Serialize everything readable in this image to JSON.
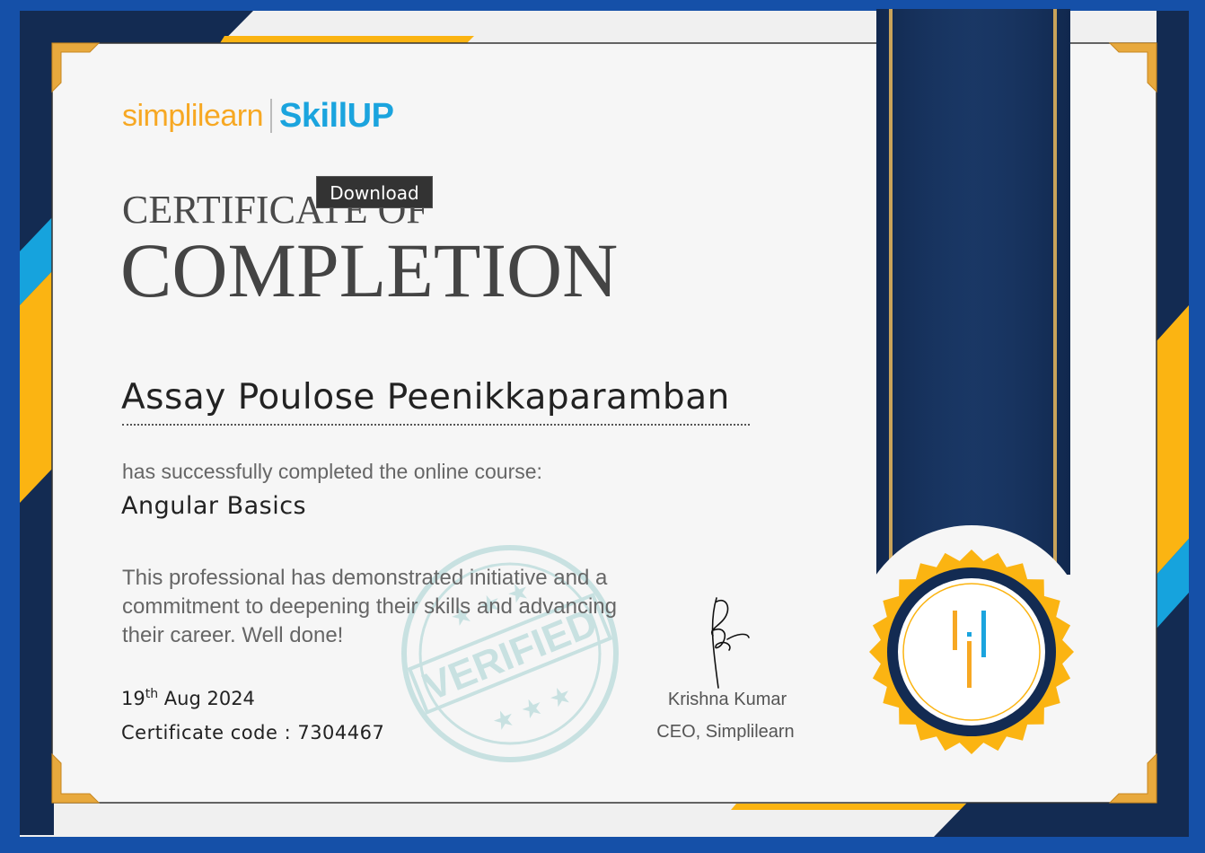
{
  "brand": {
    "simplilearn": "simplilearn",
    "skillup": "SkillUP",
    "colors": {
      "orange": "#f7a823",
      "blue": "#1ba4de",
      "navy": "#132b52",
      "gold": "#fbb412"
    }
  },
  "tooltip": {
    "label": "Download"
  },
  "certificate": {
    "title_line1": "CERTIFICATE OF",
    "title_line2": "COMPLETION",
    "recipient_name": "Assay Poulose Peenikkaparamban",
    "completed_text": "has successfully completed the online course:",
    "course_name": "Angular Basics",
    "description": "This professional has demonstrated initiative and a commitment to deepening their skills and advancing their career. Well done!",
    "date_day": "19",
    "date_suffix": "th",
    "date_rest": "Aug 2024",
    "code_label": "Certificate code : ",
    "code_value": "7304467"
  },
  "stamp": {
    "text": "VERIFIED"
  },
  "signatory": {
    "name": "Krishna Kumar",
    "title": "CEO, Simplilearn"
  }
}
